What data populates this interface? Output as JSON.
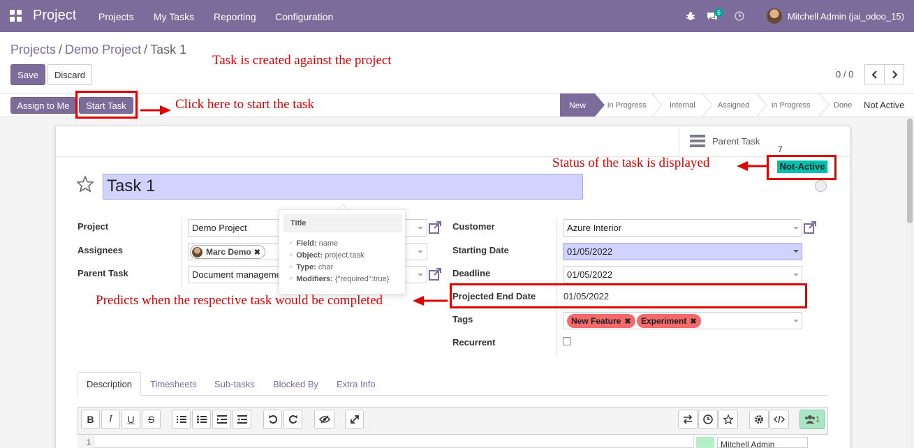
{
  "navbar": {
    "app_title": "Project",
    "menu": [
      "Projects",
      "My Tasks",
      "Reporting",
      "Configuration"
    ],
    "chat_count": "6",
    "user": "Mitchell Admin (jai_odoo_15)",
    "icons": [
      "apps-grid-icon",
      "bug-icon",
      "chat-icon",
      "clock-icon"
    ]
  },
  "breadcrumb": {
    "items": [
      "Projects",
      "Demo Project",
      "Task 1"
    ],
    "separator": "/"
  },
  "actions": {
    "save": "Save",
    "discard": "Discard",
    "pager": "0 / 0"
  },
  "status_bar": {
    "assign": "Assign to Me",
    "start": "Start Task",
    "stages": [
      "New",
      "in Progress",
      "Internal",
      "Assigned",
      "in Progress",
      "Done"
    ],
    "current_stage": "New",
    "extra": "Not Active"
  },
  "smart_button": {
    "label": "Parent Task",
    "count": "7"
  },
  "status_badge": "Not-Active",
  "task": {
    "title": "Task 1"
  },
  "left_fields": {
    "project_label": "Project",
    "project_value": "Demo Project",
    "assignees_label": "Assignees",
    "assignee": "Marc Demo",
    "parent_label": "Parent Task",
    "parent_value": "Document manageme"
  },
  "right_fields": {
    "customer_label": "Customer",
    "customer_value": "Azure Interior",
    "start_label": "Starting Date",
    "start_value": "01/05/2022",
    "deadline_label": "Deadline",
    "deadline_value": "01/05/2022",
    "projected_label": "Projected End Date",
    "projected_value": "01/05/2022",
    "tags_label": "Tags",
    "tags": [
      "New Feature",
      "Experiment"
    ],
    "recurrent_label": "Recurrent"
  },
  "tooltip": {
    "title": "Title",
    "field_k": "Field:",
    "field_v": "name",
    "object_k": "Object:",
    "object_v": "project.task",
    "type_k": "Type:",
    "type_v": "char",
    "mod_k": "Modifiers:",
    "mod_v": "{\"required\":true}"
  },
  "notebook": {
    "tabs": [
      "Description",
      "Timesheets",
      "Sub-tasks",
      "Blocked By",
      "Extra Info"
    ]
  },
  "editor": {
    "line": "1",
    "followers": "1",
    "follower_name": "Mitchell Admin",
    "buttons": [
      "B",
      "I",
      "U",
      "S"
    ]
  },
  "annotations": {
    "created": "Task is created against the project",
    "start": "Click here to start the task",
    "status": "Status of the task is displayed",
    "predicts": "Predicts when the respective task would be completed"
  },
  "colors": {
    "brand": "#7c6c9b",
    "teal": "#00c0b0",
    "tag_red": "#f46a6a",
    "anno_red": "#e00000"
  }
}
